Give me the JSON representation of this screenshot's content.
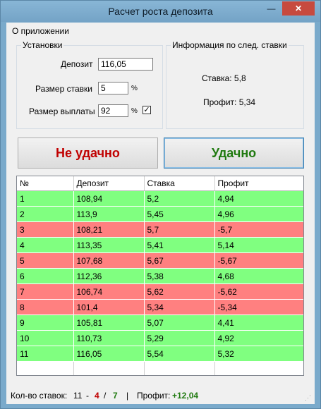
{
  "window": {
    "title": "Расчет роста депозита",
    "minimize": "—",
    "maximize": "☐",
    "close": "✕"
  },
  "menu": {
    "about": "О приложении"
  },
  "settings": {
    "legend": "Установки",
    "deposit_label": "Депозит",
    "deposit_value": "116,05",
    "rate_label": "Размер ставки",
    "rate_value": "5",
    "rate_unit": "%",
    "payout_label": "Размер выплаты",
    "payout_value": "92",
    "payout_unit": "%",
    "payout_checked": true,
    "check_mark": "✓"
  },
  "info": {
    "legend": "Информация по след. ставки",
    "rate_text": "Ставка: 5,8",
    "profit_text": "Профит: 5,34"
  },
  "buttons": {
    "fail": "Не удачно",
    "success": "Удачно"
  },
  "table": {
    "headers": [
      "№",
      "Депозит",
      "Ставка",
      "Профит"
    ],
    "rows": [
      {
        "n": "1",
        "deposit": "108,94",
        "rate": "5,2",
        "profit": "4,94",
        "status": "ok"
      },
      {
        "n": "2",
        "deposit": "113,9",
        "rate": "5,45",
        "profit": "4,96",
        "status": "ok"
      },
      {
        "n": "3",
        "deposit": "108,21",
        "rate": "5,7",
        "profit": "-5,7",
        "status": "fail"
      },
      {
        "n": "4",
        "deposit": "113,35",
        "rate": "5,41",
        "profit": "5,14",
        "status": "ok"
      },
      {
        "n": "5",
        "deposit": "107,68",
        "rate": "5,67",
        "profit": "-5,67",
        "status": "fail"
      },
      {
        "n": "6",
        "deposit": "112,36",
        "rate": "5,38",
        "profit": "4,68",
        "status": "ok"
      },
      {
        "n": "7",
        "deposit": "106,74",
        "rate": "5,62",
        "profit": "-5,62",
        "status": "fail"
      },
      {
        "n": "8",
        "deposit": "101,4",
        "rate": "5,34",
        "profit": "-5,34",
        "status": "fail"
      },
      {
        "n": "9",
        "deposit": "105,81",
        "rate": "5,07",
        "profit": "4,41",
        "status": "ok"
      },
      {
        "n": "10",
        "deposit": "110,73",
        "rate": "5,29",
        "profit": "4,92",
        "status": "ok"
      },
      {
        "n": "11",
        "deposit": "116,05",
        "rate": "5,54",
        "profit": "5,32",
        "status": "ok"
      }
    ]
  },
  "status": {
    "count_label": "Кол-во ставок:",
    "total": "11",
    "dash": "-",
    "fails": "4",
    "slash": "/",
    "wins": "7",
    "separator": "|",
    "profit_label": "Профит:",
    "profit_value": "+12,04",
    "grip": "⋰"
  },
  "colors": {
    "success_row": "#80ff80",
    "fail_row": "#ff8080",
    "fail_text": "#c00000",
    "success_text": "#207a10"
  }
}
